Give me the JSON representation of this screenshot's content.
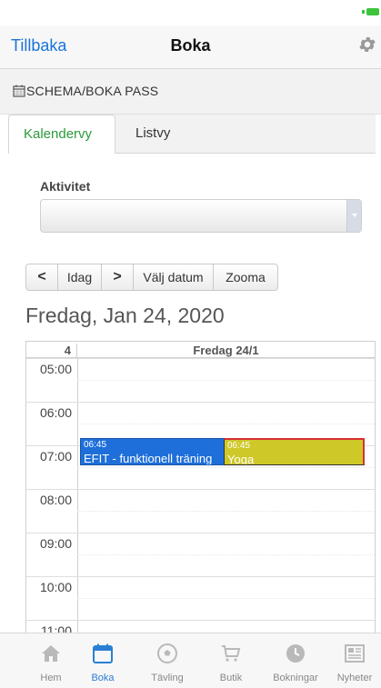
{
  "nav": {
    "back_label": "Tillbaka",
    "title": "Boka"
  },
  "section": {
    "title": "SCHEMA/BOKA PASS"
  },
  "tabs": [
    {
      "label": "Kalendervy",
      "active": true
    },
    {
      "label": "Listvy",
      "active": false
    }
  ],
  "activity": {
    "label": "Aktivitet",
    "value": ""
  },
  "toolbar": {
    "prev": "<",
    "today": "Idag",
    "next": ">",
    "pick_date": "Välj datum",
    "zoom": "Zooma"
  },
  "date_title": "Fredag, Jan 24, 2020",
  "calendar": {
    "week_number": "4",
    "day_header": "Fredag 24/1",
    "times": [
      "05:00",
      "06:00",
      "07:00",
      "08:00",
      "09:00",
      "10:00",
      "11:00"
    ],
    "events": [
      {
        "time": "06:45",
        "name": "EFIT - funktionell träning",
        "color": "#1e6fd9"
      },
      {
        "time": "06:45",
        "name": "Yoga",
        "color": "#cfc829"
      }
    ]
  },
  "tabbar": [
    {
      "label": "Hem",
      "icon": "home-icon",
      "active": false
    },
    {
      "label": "Boka",
      "icon": "calendar-icon",
      "active": true
    },
    {
      "label": "Tävling",
      "icon": "soccer-ball-icon",
      "active": false
    },
    {
      "label": "Butik",
      "icon": "cart-icon",
      "active": false
    },
    {
      "label": "Bokningar",
      "icon": "clock-icon",
      "active": false
    },
    {
      "label": "Nyheter",
      "icon": "newspaper-icon",
      "active": false
    }
  ],
  "colors": {
    "accent_blue": "#1a73d8",
    "active_tab_green": "#2a9a3a",
    "battery_green": "#3cc43c"
  }
}
